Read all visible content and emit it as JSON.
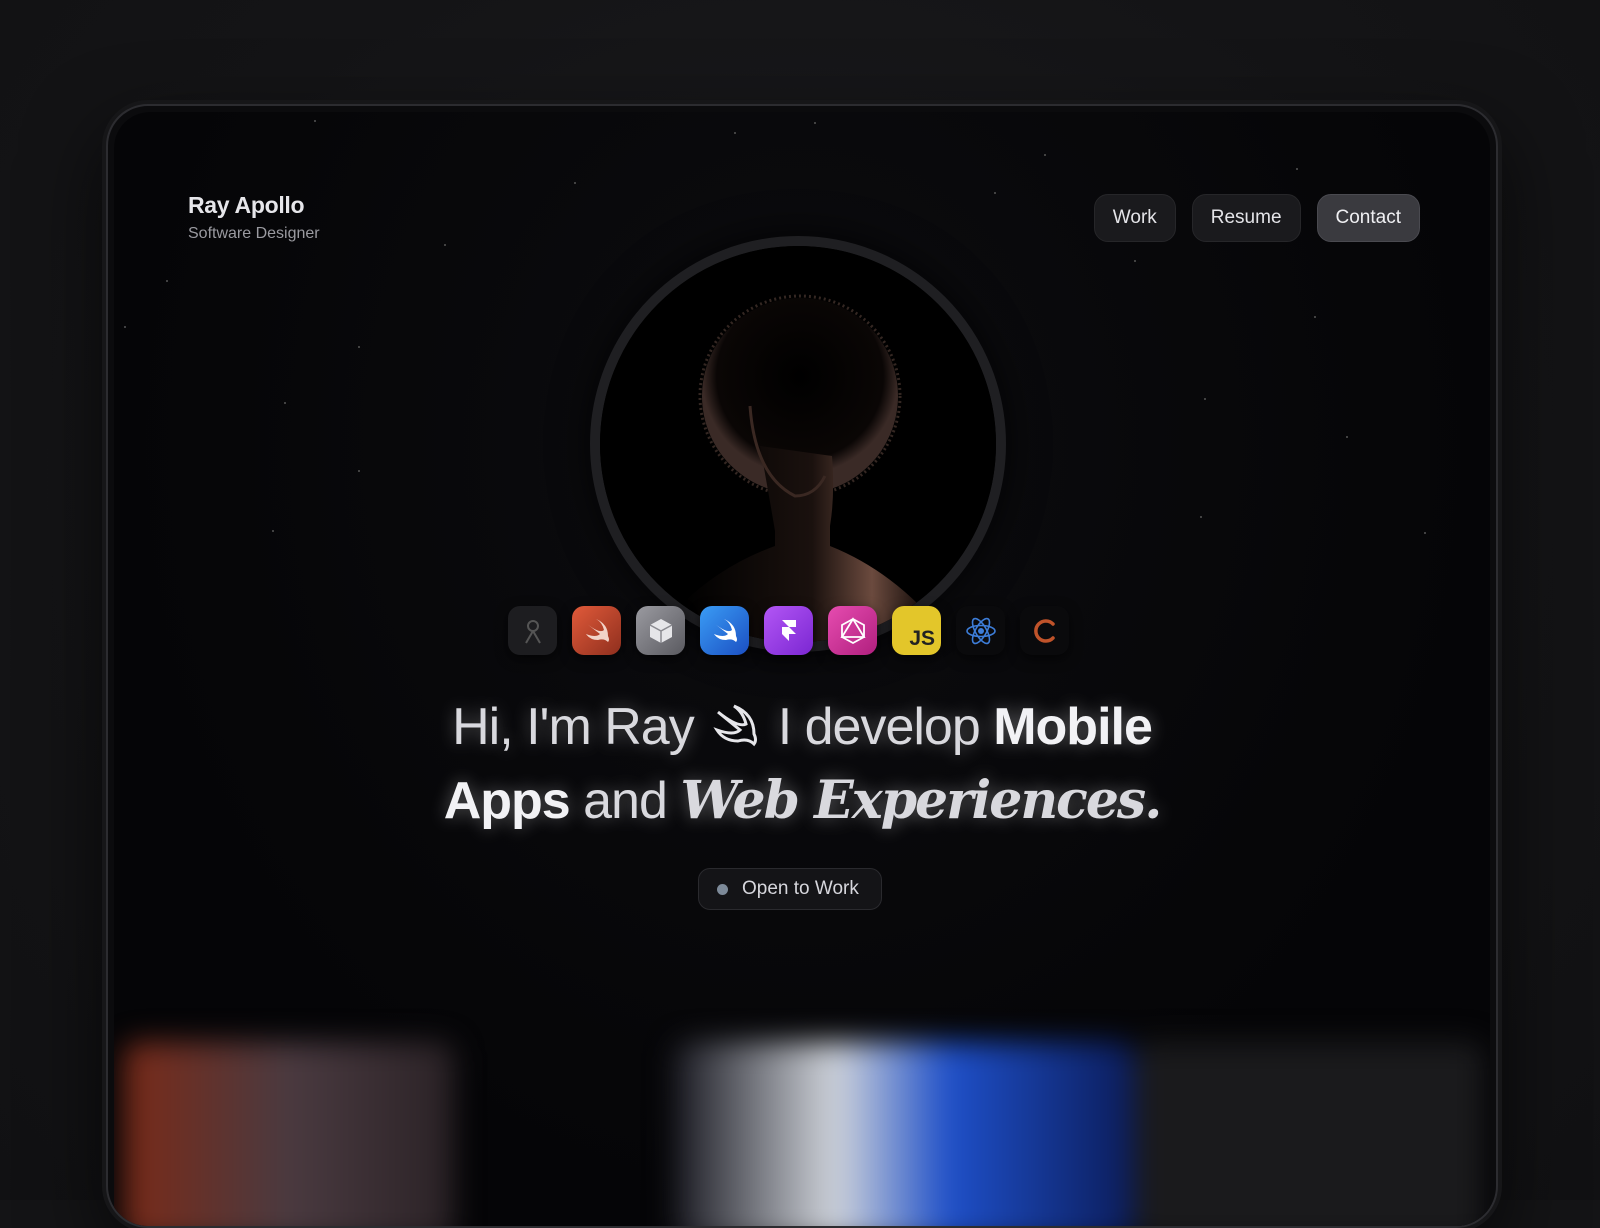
{
  "brand": {
    "name": "Ray Apollo",
    "role": "Software Designer"
  },
  "nav": {
    "items": [
      {
        "label": "Work",
        "active": false
      },
      {
        "label": "Resume",
        "active": false
      },
      {
        "label": "Contact",
        "active": true
      }
    ]
  },
  "tools": [
    {
      "icon": "instruments-icon",
      "color": "#1d1d20"
    },
    {
      "icon": "swift-orange-icon",
      "color": "#c0492e"
    },
    {
      "icon": "cube-icon",
      "color": "#8a8a90"
    },
    {
      "icon": "swift-blue-icon",
      "color": "#2f7fe3"
    },
    {
      "icon": "framer-icon",
      "color": "#9b3fe6"
    },
    {
      "icon": "graphql-icon",
      "color": "#d8359c"
    },
    {
      "icon": "javascript-icon",
      "color": "#e3c62a",
      "text": "JS"
    },
    {
      "icon": "react-icon",
      "color": "#0a0a0c"
    },
    {
      "icon": "loading-c-icon",
      "color": "#0a0a0c"
    }
  ],
  "headline": {
    "greeting": "Hi, I'm Ray",
    "lead": "I develop",
    "mobile": "Mobile",
    "apps": "Apps",
    "and": "and",
    "web": "Web Experiences."
  },
  "status": {
    "label": "Open to Work",
    "dot_color": "#7d8a99"
  }
}
